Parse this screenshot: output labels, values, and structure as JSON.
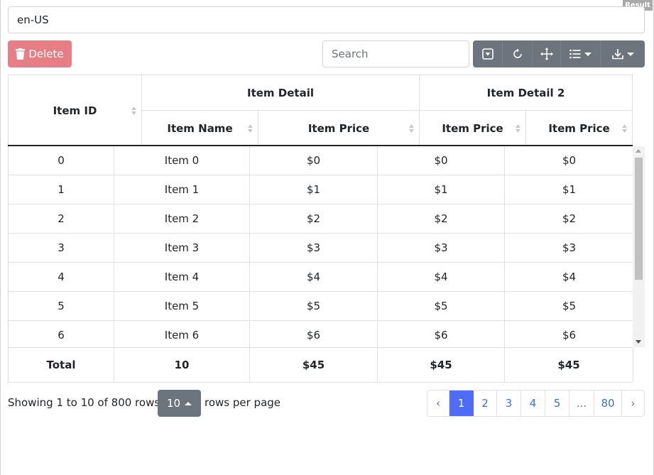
{
  "result_tag": "Result",
  "locale": {
    "value": "en-US"
  },
  "toolbar": {
    "delete_label": "Delete",
    "search_placeholder": "Search",
    "buttons": [
      {
        "icon": "toggle-view-icon"
      },
      {
        "icon": "refresh-icon"
      },
      {
        "icon": "move-icon"
      },
      {
        "icon": "columns-list-icon"
      },
      {
        "icon": "export-download-icon"
      }
    ]
  },
  "table": {
    "group_headers": [
      "Item Detail",
      "Item Detail 2"
    ],
    "columns": [
      "Item ID",
      "Item Name",
      "Item Price",
      "Item Price",
      "Item Price"
    ],
    "rows": [
      [
        "0",
        "Item 0",
        "$0",
        "$0",
        "$0"
      ],
      [
        "1",
        "Item 1",
        "$1",
        "$1",
        "$1"
      ],
      [
        "2",
        "Item 2",
        "$2",
        "$2",
        "$2"
      ],
      [
        "3",
        "Item 3",
        "$3",
        "$3",
        "$3"
      ],
      [
        "4",
        "Item 4",
        "$4",
        "$4",
        "$4"
      ],
      [
        "5",
        "Item 5",
        "$5",
        "$5",
        "$5"
      ],
      [
        "6",
        "Item 6",
        "$6",
        "$6",
        "$6"
      ]
    ],
    "footer": [
      "Total",
      "10",
      "$45",
      "$45",
      "$45"
    ]
  },
  "pagination": {
    "info": "Showing 1 to 10 of 800 rows",
    "page_size": "10",
    "rows_per_page": "rows per page",
    "pages": [
      "‹",
      "1",
      "2",
      "3",
      "4",
      "5",
      "...",
      "80",
      "›"
    ],
    "active_page": "1"
  },
  "colors": {
    "delete": "#e87e85",
    "toolbar": "#6c757d",
    "active_page": "#4f6cf7",
    "link": "#3a6ee8"
  }
}
